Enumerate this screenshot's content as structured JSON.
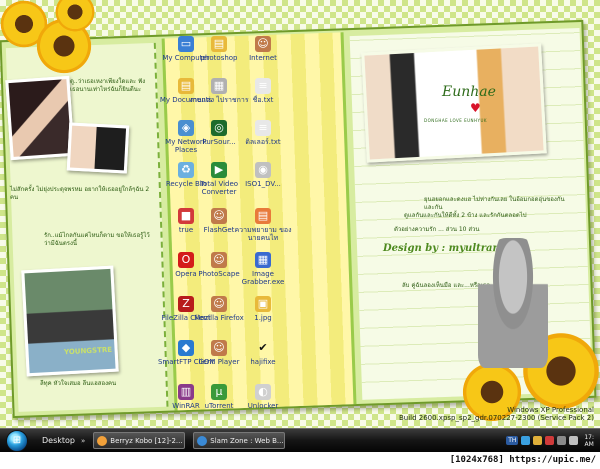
{
  "desktop": {
    "board": {
      "left_caption_1": "ดู..ว่าเธอเหงาเพียงใดและ ฟังเธอนานเท่าไหร่ฉันก็ยินดีนะ",
      "left_caption_2": "ไม่สักครั้ง ไม่ยุ่งประดุจพรหม อยากให้เธออยู่ใกล้ๆฉัน 2 คน",
      "left_caption_3": "รัก..แม้ไกลกันแค่ไหนก็ตาม ขอให้เธอรู้ไว้ว่ามีฉันตรงนี้",
      "left_caption_4": "ลีทุค หัวใจเสมอ ลีนแฮสองคน",
      "shirt_text": "YOUNGSTRE",
      "script_title": "Eunhae",
      "subtitle": "DONGHAE LOVE EUNHYUK",
      "right_text_1": "ยุนฮยอกและดงแฮ ไม่ห่างกันเลย ในอ้อมกอดอุ่นของกันและกัน",
      "right_text_2": "ดูแลกันและกันให้ดีทั้ง 2 ข้าง และรักกันตลอดไป",
      "right_text_3": "ตัวอย่างความรัก ... ส่วน 10 ส่วน",
      "design_credit": "Design by : myultraman",
      "hoodie_caption": "ลับ คู่ฉันลองเห็นมือ และ...หรือเธอ"
    },
    "icons": [
      {
        "name": "my-computer-icon",
        "label": "My Computer",
        "color": "#3a7fd5",
        "glyph": "▭"
      },
      {
        "name": "photoshop-icon",
        "label": "photoshop",
        "color": "#e8b93a",
        "glyph": "▤"
      },
      {
        "name": "internet-icon",
        "label": "Internet",
        "color": "#c07a4a",
        "glyph": "☺"
      },
      {
        "name": "my-documents-icon",
        "label": "My Documents",
        "color": "#e8b93a",
        "glyph": "▤"
      },
      {
        "name": "thai-folder-icon",
        "label": "งานแต่ง ไปราชการ",
        "color": "#b0b0b0",
        "glyph": "▦"
      },
      {
        "name": "text-file-icon",
        "label": "ชื่อ.txt",
        "color": "#e8e8e8",
        "glyph": "≡"
      },
      {
        "name": "network-places-icon",
        "label": "My Network Places",
        "color": "#4a8fd0",
        "glyph": "◈"
      },
      {
        "name": "pursour-icon",
        "label": "PurSour...",
        "color": "#1d6b2c",
        "glyph": "◎"
      },
      {
        "name": "text-file-2-icon",
        "label": "ดิลเลอร์.txt",
        "color": "#e8e8e8",
        "glyph": "≡"
      },
      {
        "name": "recycle-bin-icon",
        "label": "Recycle Bin",
        "color": "#6bb0e0",
        "glyph": "♻"
      },
      {
        "name": "total-video-converter-icon",
        "label": "Total Video Converter",
        "color": "#2a8c3a",
        "glyph": "▶"
      },
      {
        "name": "iso-file-icon",
        "label": "ISO1_DV...",
        "color": "#c0c0c0",
        "glyph": "◉"
      },
      {
        "name": "true-icon",
        "label": "true",
        "color": "#d23a3a",
        "glyph": "■"
      },
      {
        "name": "flashget-icon",
        "label": "FlashGet",
        "color": "#c07a4a",
        "glyph": "☺"
      },
      {
        "name": "thai-doc-icon",
        "label": "ความพยายาม ของนายคนไท",
        "color": "#e87a3a",
        "glyph": "▤"
      },
      {
        "name": "opera-icon",
        "label": "Opera",
        "color": "#d41a1a",
        "glyph": "O"
      },
      {
        "name": "photoscape-icon",
        "label": "PhotoScape",
        "color": "#c07a4a",
        "glyph": "☺"
      },
      {
        "name": "image-grabber-icon",
        "label": "Image Grabber.exe",
        "color": "#3a6ad0",
        "glyph": "▦"
      },
      {
        "name": "filezilla-icon",
        "label": "FileZilla Client",
        "color": "#b81c1c",
        "glyph": "Z"
      },
      {
        "name": "mozilla-firefox-icon",
        "label": "Mozilla Firefox",
        "color": "#c07a4a",
        "glyph": "☺"
      },
      {
        "name": "jpg-file-icon",
        "label": "1.jpg",
        "color": "#e8b93a",
        "glyph": "▣"
      },
      {
        "name": "smartftp-icon",
        "label": "SmartFTP Client",
        "color": "#2a7ad0",
        "glyph": "◆"
      },
      {
        "name": "gom-player-icon",
        "label": "GOM Player",
        "color": "#c07a4a",
        "glyph": "☺"
      },
      {
        "name": "hajifixe-icon",
        "label": "hajifixe",
        "color": "transparent",
        "glyph": "✔"
      },
      {
        "name": "winrar-icon",
        "label": "WinRAR",
        "color": "#8a3a8a",
        "glyph": "▥"
      },
      {
        "name": "utorrent-icon",
        "label": "uTorrent",
        "color": "#3a9a3a",
        "glyph": "µ"
      },
      {
        "name": "unlocker-icon",
        "label": "Unlocker",
        "color": "#d0d0d0",
        "glyph": "◐"
      }
    ],
    "os_info": {
      "line1": "Windows XP Professional",
      "line2": "Build 2600.xpsp_sp2_gdr.070227-2300 (Service Pack 2)"
    }
  },
  "taskbar": {
    "start_glyph": "⊞",
    "toolbar_label": "Desktop",
    "chevron": "»",
    "tasks": [
      {
        "label": "Berryz Kobo [12]-2...",
        "color": "#f2a13a"
      },
      {
        "label": "Slam Zone : Web B...",
        "color": "#3a8ad6"
      }
    ],
    "tray": [
      {
        "name": "language-icon",
        "label": "TH",
        "color": "#2a5aa0"
      },
      {
        "name": "tray-app-icon-1",
        "label": "",
        "color": "#3aa0e0"
      },
      {
        "name": "tray-app-icon-2",
        "label": "",
        "color": "#e0b03a"
      },
      {
        "name": "tray-app-icon-3",
        "label": "",
        "color": "#d03a3a"
      },
      {
        "name": "tray-app-icon-4",
        "label": "",
        "color": "#8a8a8a"
      },
      {
        "name": "volume-icon",
        "label": "",
        "color": "#c0c0c0"
      }
    ],
    "clock": {
      "time": "17:",
      "period": "AM"
    }
  },
  "caption": "[1024x768] https://upic.me/"
}
